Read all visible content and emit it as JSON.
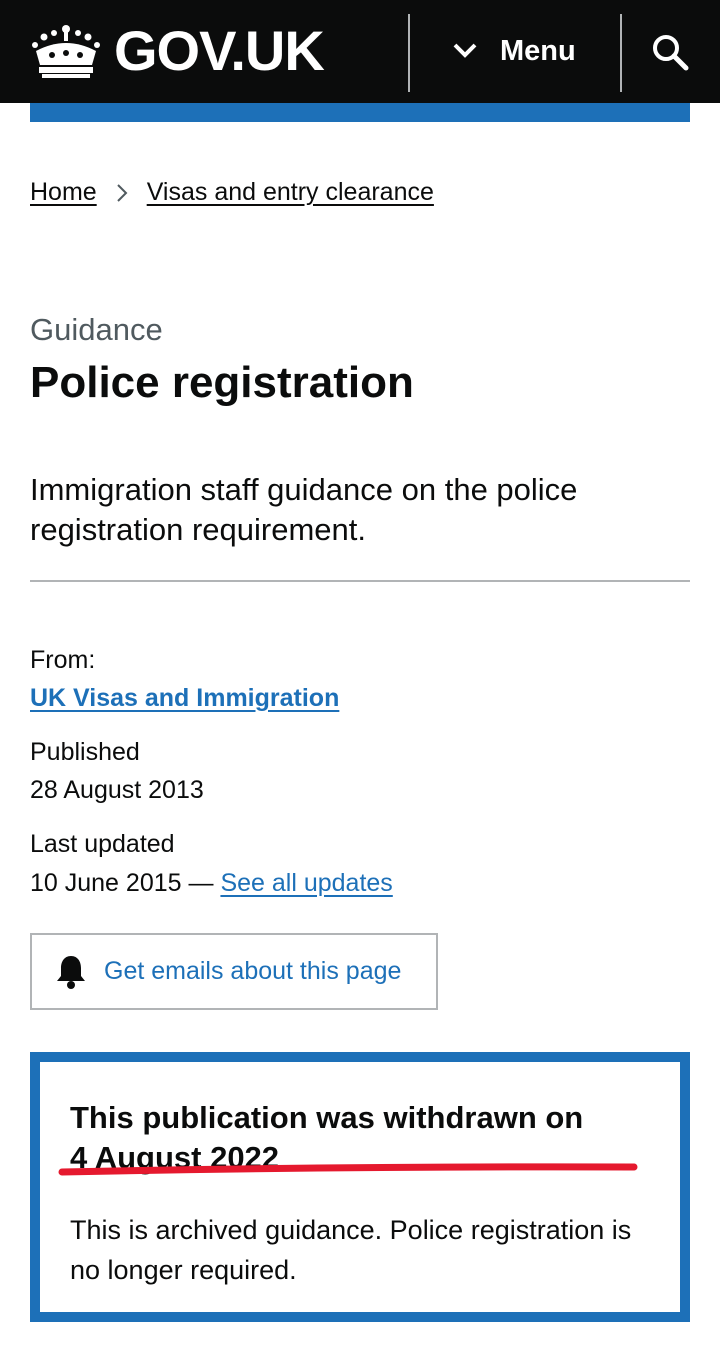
{
  "header": {
    "logo_text": "GOV.UK",
    "menu_label": "Menu",
    "icons": {
      "crown": "crown-icon",
      "menu": "chevron-down-icon",
      "search": "search-icon"
    },
    "colors": {
      "background": "#0b0c0c",
      "accent_bar": "#1d70b8"
    }
  },
  "breadcrumb": {
    "items": [
      {
        "label": "Home"
      },
      {
        "label": "Visas and entry clearance"
      }
    ]
  },
  "page": {
    "caption": "Guidance",
    "title": "Police registration",
    "lead": "Immigration staff guidance on the police registration requirement."
  },
  "metadata": {
    "from_label": "From:",
    "organisation": "UK Visas and Immigration",
    "published_label": "Published",
    "published_date": "28 August 2013",
    "updated_label": "Last updated",
    "updated_date": "10 June 2015 —",
    "see_updates_link": "See all updates"
  },
  "email_button": {
    "label": "Get emails about this page",
    "icon": "bell-icon"
  },
  "withdrawn_notice": {
    "title_line1": "This publication was withdrawn on",
    "title_line2": "4 August 2022",
    "body": "This is archived guidance. Police registration is no longer required.",
    "border_color": "#1d70b8",
    "annotation_color": "#e5192e"
  }
}
